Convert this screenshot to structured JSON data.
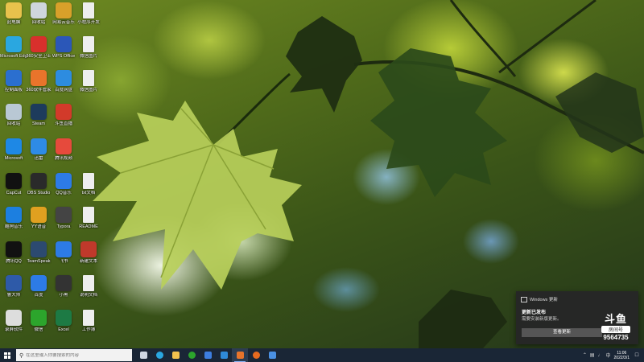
{
  "desktop": {
    "icons": [
      {
        "label": "此电脑",
        "color": "#e8c24c"
      },
      {
        "label": "回收站",
        "color": "#cfd6dc"
      },
      {
        "label": "网易云音乐",
        "color": "#d8a02a"
      },
      {
        "label": "小程序开发",
        "color": "#eeeeee"
      },
      {
        "label": "Microsoft Edge",
        "color": "#2aa7e0"
      },
      {
        "label": "360安全卫士",
        "color": "#d8302c"
      },
      {
        "label": "WPS Office",
        "color": "#2b57b8"
      },
      {
        "label": "微信图片",
        "color": "#eeeeee"
      },
      {
        "label": "控制面板",
        "color": "#2b6fcf"
      },
      {
        "label": "360软件管家",
        "color": "#e9742b"
      },
      {
        "label": "百度网盘",
        "color": "#2d8ce0"
      },
      {
        "label": "微信图片",
        "color": "#eeeeee"
      },
      {
        "label": "回收站",
        "color": "#b9c8d4"
      },
      {
        "label": "Steam",
        "color": "#1d3b5c"
      },
      {
        "label": "斗鱼直播",
        "color": "#d23a2a"
      },
      {
        "label": "Microsoft",
        "color": "#1e88e5"
      },
      {
        "label": "迅雷",
        "color": "#2e8be6"
      },
      {
        "label": "腾讯视频",
        "color": "#e64a3c"
      },
      {
        "label": "CapCut",
        "color": "#111111"
      },
      {
        "label": "OBS Studio",
        "color": "#2a2a2a"
      },
      {
        "label": "QQ音乐",
        "color": "#2d7be6"
      },
      {
        "label": "txt文档",
        "color": "#eeeeee"
      },
      {
        "label": "酷狗音乐",
        "color": "#1c7fe0"
      },
      {
        "label": "YY语音",
        "color": "#e0a020"
      },
      {
        "label": "Typora",
        "color": "#444444"
      },
      {
        "label": "README",
        "color": "#eeeeee"
      },
      {
        "label": "腾讯QQ",
        "color": "#111111"
      },
      {
        "label": "TeamSpeak",
        "color": "#2c4a70"
      },
      {
        "label": "飞书",
        "color": "#2d7be6"
      },
      {
        "label": "新建文本",
        "color": "#c0392b"
      },
      {
        "label": "鲁大师",
        "color": "#2e5aa8"
      },
      {
        "label": "百度",
        "color": "#2d7be6"
      },
      {
        "label": "小黑",
        "color": "#333333"
      },
      {
        "label": "说明文档",
        "color": "#eeeeee"
      },
      {
        "label": "录屏软件",
        "color": "#dddddd"
      },
      {
        "label": "微信",
        "color": "#2ca52c"
      },
      {
        "label": "Excel",
        "color": "#1d7a44"
      },
      {
        "label": "工作簿",
        "color": "#eeeeee"
      }
    ]
  },
  "notification": {
    "app_name": "Windows 更新",
    "title": "更新已发布",
    "body": "需要安装新版更新。",
    "button_label": "查看更新"
  },
  "watermark": {
    "logo_text": "斗鱼",
    "sub_text": "房间号",
    "room_number": "9564735"
  },
  "taskbar": {
    "search_placeholder": "在这里输入你要搜索的内容",
    "apps": [
      {
        "name": "task-view",
        "color": "#cfd8e3",
        "active": false
      },
      {
        "name": "edge",
        "color": "#2aa7e0",
        "active": false
      },
      {
        "name": "explorer",
        "color": "#f2c14e",
        "active": false
      },
      {
        "name": "wechat",
        "color": "#2ca52c",
        "active": false
      },
      {
        "name": "qq-browser",
        "color": "#3d7ee0",
        "active": false
      },
      {
        "name": "vscode",
        "color": "#2f8ad8",
        "active": false
      },
      {
        "name": "douyu",
        "color": "#e8742b",
        "active": true
      },
      {
        "name": "firefox",
        "color": "#e66a1f",
        "active": false
      },
      {
        "name": "settings",
        "color": "#4a90e2",
        "active": false
      }
    ],
    "clock_time": "11:06",
    "clock_date": "2022/3/1"
  }
}
